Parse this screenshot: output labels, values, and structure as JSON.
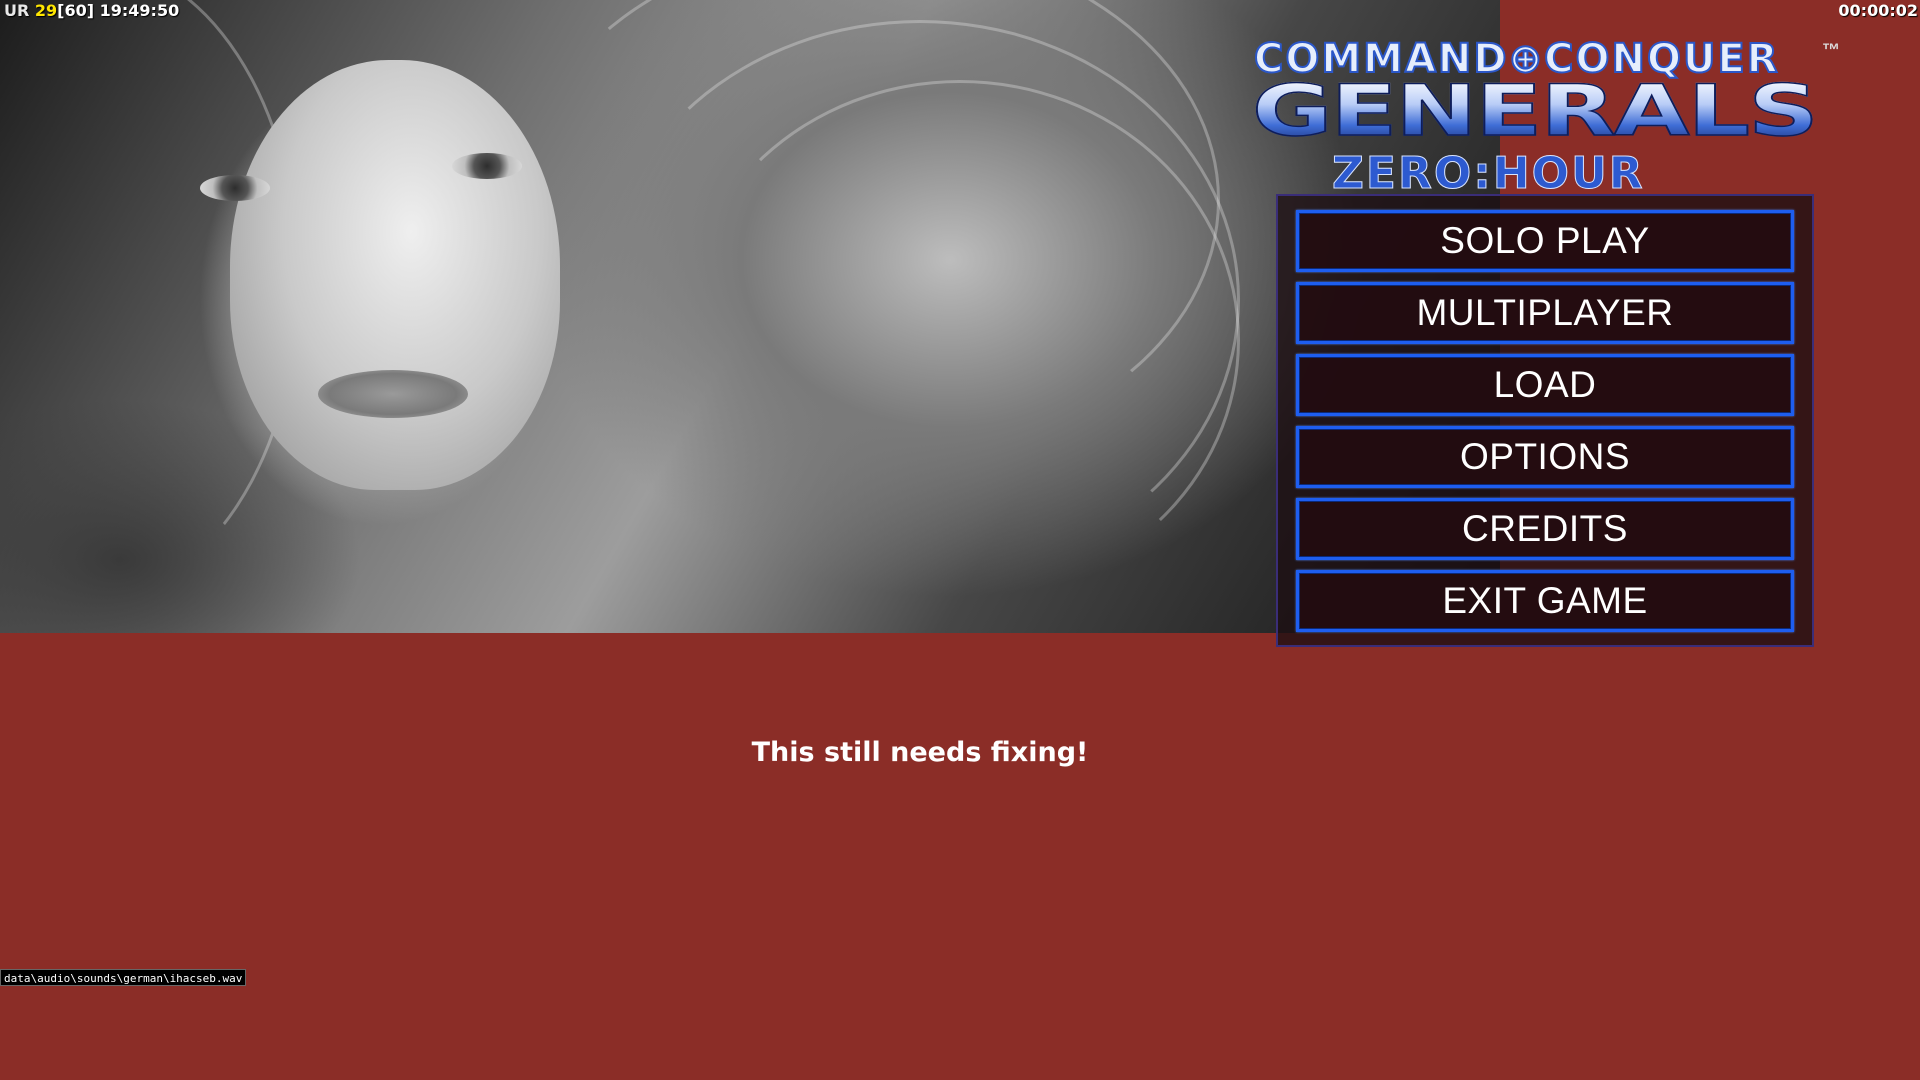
{
  "hud": {
    "prefix": "UR",
    "fps": "29",
    "fps_cap": "[60]",
    "clock": "19:49:50",
    "elapsed": "00:00:02"
  },
  "logo": {
    "top_line": "COMMAND⊕CONQUER",
    "trademark": "™",
    "main": "GENERALS",
    "subtitle": "ZERO:HOUR"
  },
  "menu": {
    "buttons": [
      {
        "label": "SOLO PLAY"
      },
      {
        "label": "MULTIPLAYER"
      },
      {
        "label": "LOAD"
      },
      {
        "label": "OPTIONS"
      },
      {
        "label": "CREDITS"
      },
      {
        "label": "EXIT GAME"
      }
    ]
  },
  "message": "This still needs fixing!",
  "debug": {
    "sound_path": "data\\audio\\sounds\\german\\ihacseb.wav"
  },
  "colors": {
    "background": "#8b2d27",
    "button_border": "#1e5ef0",
    "fps_highlight": "#ffe600"
  }
}
